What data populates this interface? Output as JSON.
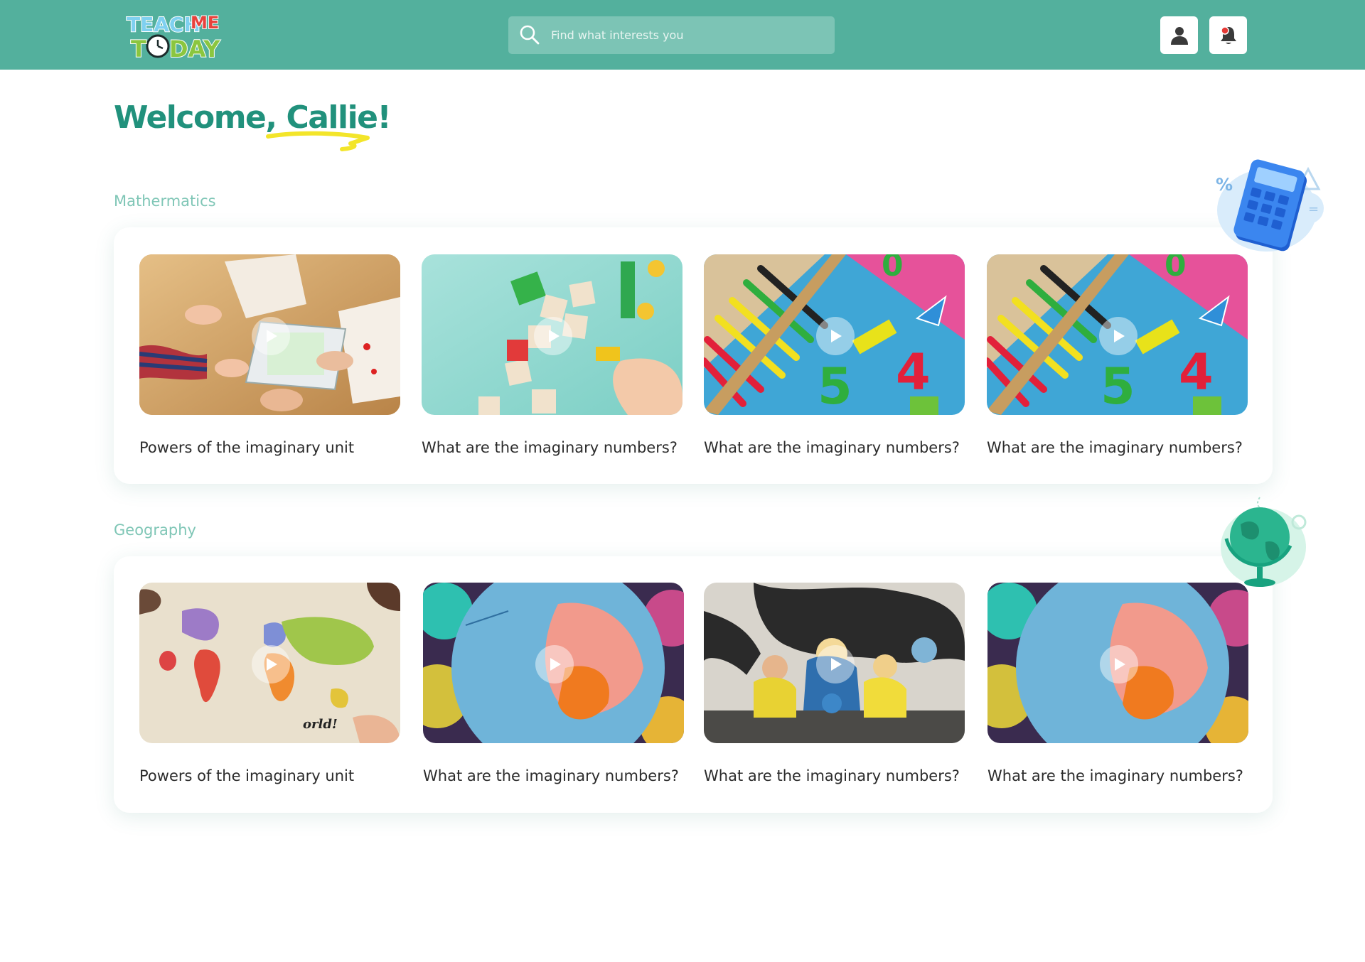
{
  "header": {
    "logo_text_top": "TEACH ME",
    "logo_text_bottom": "TODAY",
    "search_placeholder": "Find what interests you",
    "profile_icon": "user-icon",
    "notification_icon": "bell-icon"
  },
  "welcome": {
    "greeting": "Welcome,",
    "name": "Callie!"
  },
  "sections": [
    {
      "title": "Mathermatics",
      "cards": [
        {
          "title": "Powers of the imaginary unit",
          "image": "kids-tablet-drawing"
        },
        {
          "title": "What are the imaginary numbers?",
          "image": "number-blocks"
        },
        {
          "title": "What are the imaginary numbers?",
          "image": "abacus-numbers"
        },
        {
          "title": "What are the imaginary numbers?",
          "image": "abacus-numbers"
        }
      ]
    },
    {
      "title": "Geography",
      "cards": [
        {
          "title": "Powers of the imaginary unit",
          "image": "world-map-puzzle"
        },
        {
          "title": "What are the imaginary numbers?",
          "image": "globe-closeup"
        },
        {
          "title": "What are the imaginary numbers?",
          "image": "teacher-with-kids-globe"
        },
        {
          "title": "What are the imaginary numbers?",
          "image": "globe-closeup"
        }
      ]
    }
  ],
  "colors": {
    "header": "#53b09d",
    "accent": "#21917c",
    "section_title": "#7fc6b6",
    "underline": "#f3e52a"
  }
}
